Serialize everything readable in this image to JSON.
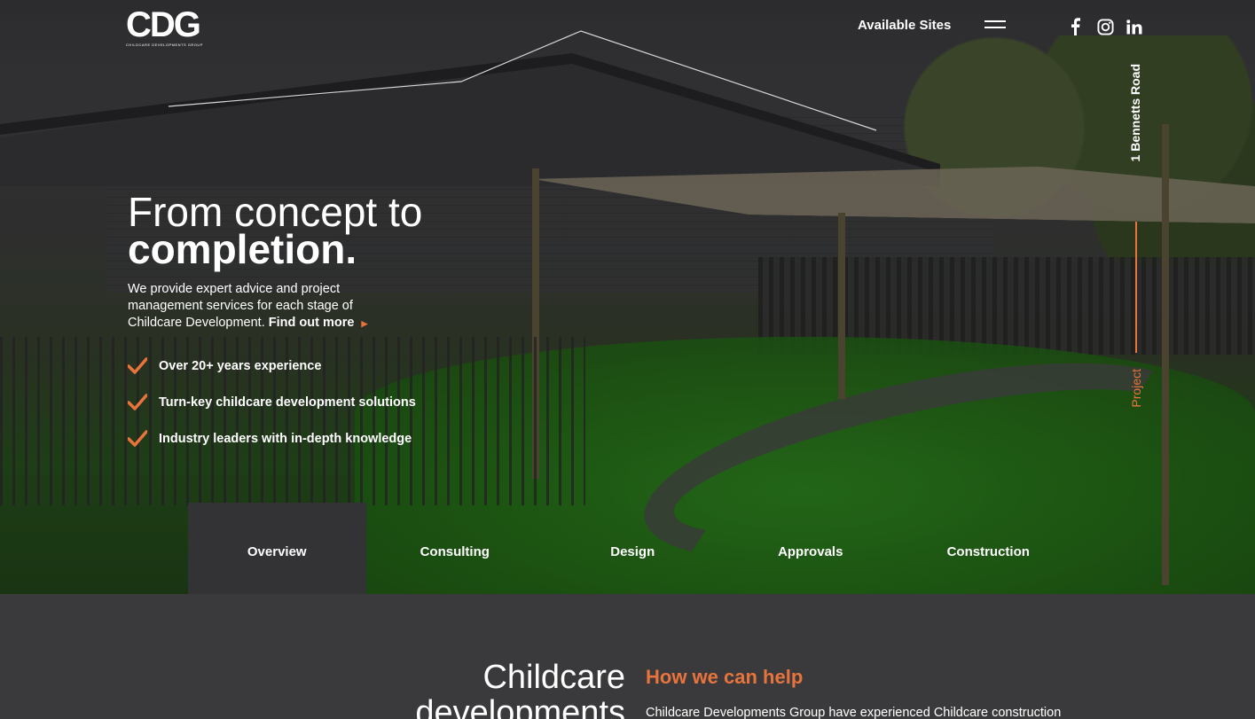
{
  "brand": {
    "logo_text": "CDG",
    "logo_subtitle": "CHILDCARE DEVELOPMENTS GROUP"
  },
  "nav": {
    "available_sites": "Available Sites",
    "social": [
      "facebook-icon",
      "instagram-icon",
      "linkedin-icon"
    ]
  },
  "side": {
    "address": "1 Bennetts Road",
    "label": "Project"
  },
  "hero": {
    "title_line1": "From concept to",
    "title_line2": "completion.",
    "description": "We provide expert advice and project management services for each stage of Childcare Development.",
    "find_more": "Find out more",
    "checks": [
      "Over 20+ years experience",
      "Turn-key childcare development solutions",
      "Industry leaders with in-depth knowledge"
    ]
  },
  "tabs": [
    {
      "label": "Overview",
      "active": true
    },
    {
      "label": "Consulting",
      "active": false
    },
    {
      "label": "Design",
      "active": false
    },
    {
      "label": "Approvals",
      "active": false
    },
    {
      "label": "Construction",
      "active": false
    }
  ],
  "section": {
    "title_line1": "Childcare",
    "title_line2": "developments",
    "help_heading": "How we can help",
    "help_text": "Childcare Developments Group have experienced Childcare construction"
  },
  "colors": {
    "accent": "#e8743b",
    "background": "#3a3a3c",
    "active_tab": "#333336"
  }
}
